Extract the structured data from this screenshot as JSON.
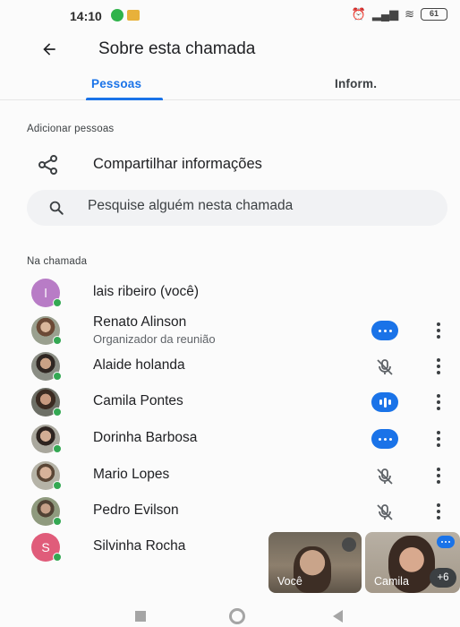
{
  "status_bar": {
    "time": "14:10",
    "battery": "61"
  },
  "header": {
    "title": "Sobre esta chamada"
  },
  "tabs": [
    {
      "label": "Pessoas",
      "active": true
    },
    {
      "label": "Inform.",
      "active": false
    }
  ],
  "add_people": {
    "section_label": "Adicionar pessoas",
    "share_label": "Compartilhar informações",
    "search_placeholder": "Pesquise alguém nesta chamada"
  },
  "in_call": {
    "section_label": "Na chamada",
    "participants": [
      {
        "name": "lais ribeiro (você)",
        "initial": "l",
        "avatar_color": "#b87cc6",
        "status": "none"
      },
      {
        "name": "Renato Alinson",
        "subtitle": "Organizador da reunião",
        "status": "speaking"
      },
      {
        "name": "Alaide holanda",
        "status": "muted"
      },
      {
        "name": "Camila Pontes",
        "status": "speaking-bars"
      },
      {
        "name": "Dorinha Barbosa",
        "status": "speaking"
      },
      {
        "name": "Mario Lopes",
        "status": "muted"
      },
      {
        "name": "Pedro Evilson",
        "status": "muted"
      },
      {
        "name": "Silvinha Rocha",
        "initial": "S",
        "avatar_color": "#e05c7a",
        "status": "none"
      }
    ]
  },
  "video_tiles": {
    "self_label": "Você",
    "other_label": "Camila",
    "more_count": "+6"
  },
  "colors": {
    "accent": "#1a73e8",
    "online": "#34a853"
  }
}
